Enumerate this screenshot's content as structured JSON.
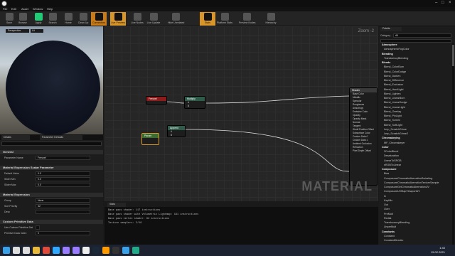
{
  "menu": [
    "File",
    "Edit",
    "Asset",
    "Window",
    "Help"
  ],
  "toolbar": [
    {
      "label": "Save",
      "icon": "save-icon"
    },
    {
      "label": "Browse",
      "icon": "browse-icon"
    },
    {
      "label": "Apply",
      "icon": "apply-icon"
    },
    {
      "label": "Search",
      "icon": "search-icon"
    },
    {
      "label": "Home",
      "icon": "home-icon"
    },
    {
      "label": "Clean Up",
      "icon": "cleanup-icon"
    },
    {
      "label": "Connectors",
      "icon": "connectors-icon"
    },
    {
      "label": "Live Preview",
      "icon": "live-preview-icon"
    },
    {
      "label": "Live Nodes",
      "icon": "live-nodes-icon"
    },
    {
      "label": "Live Update",
      "icon": "live-update-icon"
    },
    {
      "label": "Hide Unrelated",
      "icon": "hide-unrelated-icon"
    },
    {
      "label": "Stats",
      "icon": "stats-icon"
    },
    {
      "label": "Platform Stats",
      "icon": "platform-stats-icon"
    },
    {
      "label": "Preview Nodes",
      "icon": "preview-nodes-icon"
    },
    {
      "label": "Hierarchy",
      "icon": "hierarchy-icon"
    }
  ],
  "viewport": {
    "tab1": "Perspective",
    "tab2": "Lit"
  },
  "details": {
    "tab1": "Details",
    "tab2": "Parameter Defaults",
    "sections": [
      {
        "title": "General",
        "props": [
          {
            "k": "Parameter Name",
            "v": "Fresnel"
          }
        ]
      },
      {
        "title": "Material Expression Scalar Parameter",
        "props": [
          {
            "k": "Default Value",
            "v": "0.0"
          },
          {
            "k": "Slider Min",
            "v": "0.0"
          },
          {
            "k": "Slider Max",
            "v": "0.0"
          }
        ]
      },
      {
        "title": "Material Expression",
        "props": [
          {
            "k": "Group",
            "v": "None"
          },
          {
            "k": "Sort Priority",
            "v": "32"
          },
          {
            "k": "Desc",
            "v": ""
          }
        ]
      },
      {
        "title": "Custom Primitive Data",
        "props": [
          {
            "k": "Use Custom Primitive Dat",
            "v": ""
          },
          {
            "k": "Primitive Data Index",
            "v": "0"
          }
        ]
      }
    ]
  },
  "graph": {
    "zoom": "Zoom -2",
    "watermark": "MATERIAL",
    "nodes": {
      "fresnel": "Fresnel",
      "multiply": "Multiply",
      "append": "Append",
      "param": "Param",
      "result": "Shader"
    },
    "result_pins": [
      "Base Color",
      "Metallic",
      "Specular",
      "Roughness",
      "Anisotropy",
      "Emissive Color",
      "Opacity",
      "Opacity Mask",
      "Normal",
      "Tangent",
      "World Position Offset",
      "Subsurface Color",
      "Custom Data 0",
      "Custom Data 1",
      "Ambient Occlusion",
      "Refraction",
      "Pixel Depth Offset"
    ]
  },
  "stats": {
    "tab": "Stats",
    "lines": [
      "Base pass shader: 117 instructions",
      "Base pass shader with Volumetric Lightmap: 191 instructions",
      "Base pass vertex shader: 62 instructions",
      "Texture samplers: 2/16"
    ]
  },
  "palette": {
    "tab": "Palette",
    "category_label": "Category",
    "category_value": "All",
    "items": [
      {
        "t": "Atmosphere",
        "cat": true
      },
      {
        "t": "AtmosphericFogColor"
      },
      {
        "t": "Blending",
        "cat": true
      },
      {
        "t": "TransluencyBlending"
      },
      {
        "t": "Blends",
        "cat": true
      },
      {
        "t": "Blend_ColorBurn"
      },
      {
        "t": "Blend_ColorDodge"
      },
      {
        "t": "Blend_Darken"
      },
      {
        "t": "Blend_Difference"
      },
      {
        "t": "Blend_Exclusion"
      },
      {
        "t": "Blend_HardLight"
      },
      {
        "t": "Blend_Lighten"
      },
      {
        "t": "Blend_LinearBurn"
      },
      {
        "t": "Blend_LinearDodge"
      },
      {
        "t": "Blend_LinearLight"
      },
      {
        "t": "Blend_Overlay"
      },
      {
        "t": "Blend_PinLight"
      },
      {
        "t": "Blend_Screen"
      },
      {
        "t": "Blend_SoftLight"
      },
      {
        "t": "Lerp_ScratchGrime"
      },
      {
        "t": "Lerp_ScratchGrime2"
      },
      {
        "t": "Chromakeying",
        "cat": true
      },
      {
        "t": "MF_Chromakeyer"
      },
      {
        "t": "Color",
        "cat": true
      },
      {
        "t": "3ColorBlend"
      },
      {
        "t": "Desaturation"
      },
      {
        "t": "LinearToSRGB"
      },
      {
        "t": "sRGBToLinear"
      },
      {
        "t": "Composure",
        "cat": true
      },
      {
        "t": "Bias"
      },
      {
        "t": "ComposureChromaticAberrationSwizzling"
      },
      {
        "t": "ComposureChromaticAberrationTextureSample"
      },
      {
        "t": "ComposureGetChromaticAberrationUV"
      },
      {
        "t": "ComposureUVMapViewportUV"
      },
      {
        "t": "In"
      },
      {
        "t": "KeyMix"
      },
      {
        "t": "Out"
      },
      {
        "t": "Over"
      },
      {
        "t": "PreMult"
      },
      {
        "t": "Redist"
      },
      {
        "t": "TranslucencyBlending"
      },
      {
        "t": "UnpreMult"
      },
      {
        "t": "Constants",
        "cat": true
      },
      {
        "t": "Constant"
      },
      {
        "t": "ConstantDirectio"
      }
    ]
  },
  "clock": {
    "time": "1:40",
    "date": "15.02.2021"
  },
  "taskbar_icons": [
    "windows-icon",
    "search-icon",
    "taskview-icon",
    "explorer-icon",
    "chrome-icon",
    "photoshop-icon",
    "premiere-icon",
    "aftereffects-icon",
    "unreal-icon",
    "steam-icon",
    "illustrator-icon",
    "epic-icon",
    "files-icon",
    "media-icon"
  ]
}
